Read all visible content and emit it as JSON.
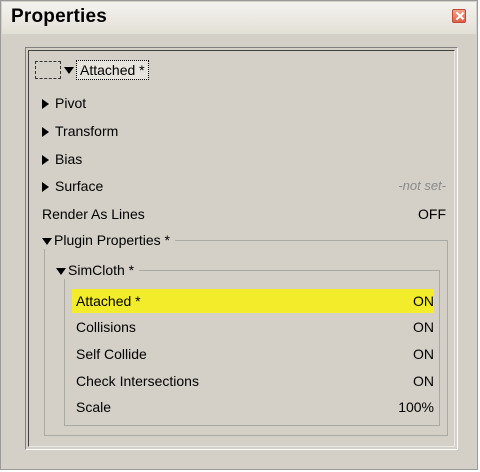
{
  "window": {
    "title": "Properties"
  },
  "header": {
    "label": "Attached *"
  },
  "rows": [
    {
      "label": "Pivot"
    },
    {
      "label": "Transform"
    },
    {
      "label": "Bias"
    },
    {
      "label": "Surface",
      "value": "-not set-"
    },
    {
      "label": "Render As Lines",
      "value": "OFF"
    }
  ],
  "plugin_group": {
    "title": "Plugin Properties *"
  },
  "simcloth_group": {
    "title": "SimCloth *"
  },
  "simcloth_rows": [
    {
      "label": "Attached *",
      "value": "ON",
      "highlighted": true
    },
    {
      "label": "Collisions",
      "value": "ON"
    },
    {
      "label": "Self Collide",
      "value": "ON"
    },
    {
      "label": "Check Intersections",
      "value": "ON"
    },
    {
      "label": "Scale",
      "value": "100%"
    }
  ],
  "colors": {
    "highlight": "#f2ec2a",
    "close_button": "#e25f44"
  }
}
